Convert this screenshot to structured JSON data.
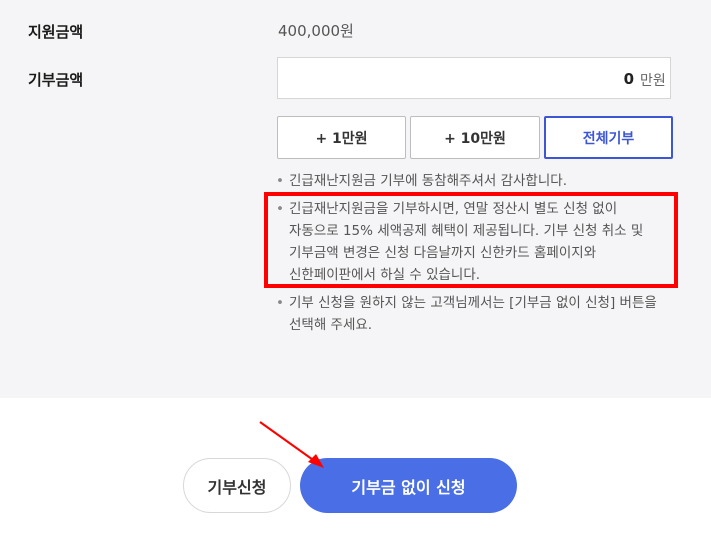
{
  "support": {
    "label": "지원금액",
    "value": "400,000원"
  },
  "donation": {
    "label": "기부금액",
    "amount": "0",
    "unit": "만원"
  },
  "buttons": {
    "add1": "+ 1만원",
    "add10": "+ 10만원",
    "all": "전체기부"
  },
  "notes": {
    "n1": "긴급재난지원금 기부에 동참해주셔서 감사합니다.",
    "n2_l1": "긴급재난지원금을 기부하시면, 연말 정산시 별도 신청 없이",
    "n2_l2": "자동으로 15% 세액공제 혜택이 제공됩니다. 기부 신청 취소 및",
    "n2_l3": "기부금액 변경은 신청 다음날까지 신한카드 홈페이지와",
    "n2_l4": "신한페이판에서 하실 수 있습니다.",
    "n3_l1": "기부 신청을 원하지 않는 고객님께서는 [기부금 없이 신청] 버튼을",
    "n3_l2": "선택해 주세요."
  },
  "bottom": {
    "apply": "기부신청",
    "apply_without": "기부금 없이 신청"
  },
  "colors": {
    "accent": "#3d56d6",
    "fill": "#4a6ee6",
    "highlight": "#ff0000"
  }
}
